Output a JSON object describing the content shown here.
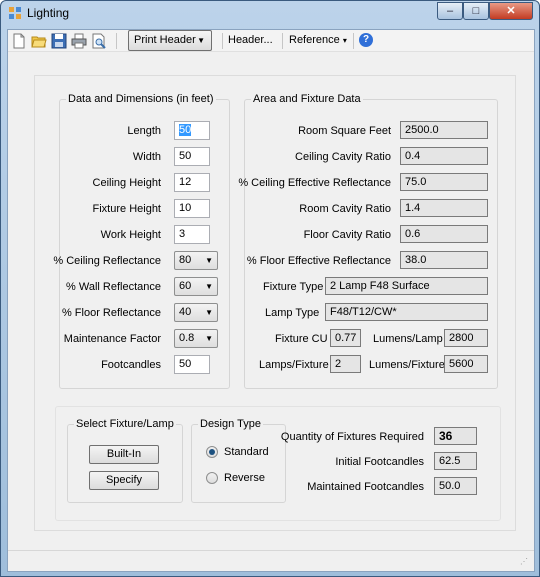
{
  "window": {
    "title": "Lighting",
    "controls": {
      "minimize": "‒",
      "maximize": "□",
      "close": "✕"
    }
  },
  "toolbar": {
    "icons": [
      "new-icon",
      "open-icon",
      "save-icon",
      "print-icon",
      "print-preview-icon"
    ],
    "print_header": "Print Header",
    "header": "Header...",
    "reference": "Reference",
    "help": "?"
  },
  "dims": {
    "title": "Data and Dimensions (in feet)",
    "rows": [
      {
        "label": "Length",
        "value": "50",
        "kind": "input"
      },
      {
        "label": "Width",
        "value": "50",
        "kind": "input"
      },
      {
        "label": "Ceiling Height",
        "value": "12",
        "kind": "input"
      },
      {
        "label": "Fixture Height",
        "value": "10",
        "kind": "input"
      },
      {
        "label": "Work Height",
        "value": "3",
        "kind": "input"
      },
      {
        "label": "% Ceiling Reflectance",
        "value": "80",
        "kind": "combo"
      },
      {
        "label": "% Wall Reflectance",
        "value": "60",
        "kind": "combo"
      },
      {
        "label": "% Floor Reflectance",
        "value": "40",
        "kind": "combo"
      },
      {
        "label": "Maintenance Factor",
        "value": "0.8",
        "kind": "combo"
      },
      {
        "label": "Footcandles",
        "value": "50",
        "kind": "input"
      }
    ]
  },
  "area": {
    "title": "Area and Fixture Data",
    "rows": [
      {
        "label": "Room Square Feet",
        "value": "2500.0"
      },
      {
        "label": "Ceiling Cavity Ratio",
        "value": "0.4"
      },
      {
        "label": "% Ceiling Effective Reflectance",
        "value": "75.0"
      },
      {
        "label": "Room Cavity Ratio",
        "value": "1.4"
      },
      {
        "label": "Floor Cavity Ratio",
        "value": "0.6"
      },
      {
        "label": "% Floor Effective Reflectance",
        "value": "38.0"
      }
    ],
    "fixture_type_label": "Fixture Type",
    "fixture_type": "2 Lamp F48 Surface",
    "lamp_type_label": "Lamp Type",
    "lamp_type": "F48/T12/CW*",
    "fixture_cu_label": "Fixture CU",
    "fixture_cu": "0.77",
    "lumens_lamp_label": "Lumens/Lamp",
    "lumens_lamp": "2800",
    "lamps_fixture_label": "Lamps/Fixture",
    "lamps_fixture": "2",
    "lumens_fixture_label": "Lumens/Fixture",
    "lumens_fixture": "5600"
  },
  "select": {
    "title": "Select Fixture/Lamp",
    "built_in": "Built-In",
    "specify": "Specify"
  },
  "design": {
    "title": "Design Type",
    "standard": "Standard",
    "reverse": "Reverse",
    "selected": "Standard"
  },
  "results": {
    "qty_label": "Quantity of Fixtures Required",
    "qty": "36",
    "initial_label": "Initial Footcandles",
    "initial": "62.5",
    "maintained_label": "Maintained  Footcandles",
    "maintained": "50.0"
  }
}
